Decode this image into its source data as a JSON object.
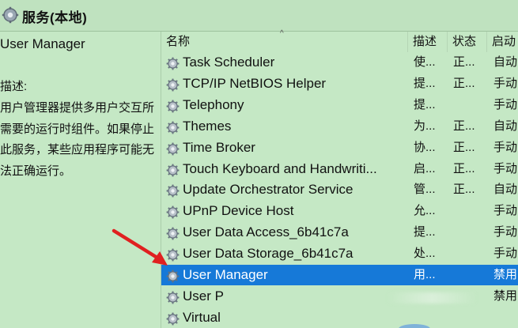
{
  "header": {
    "title": "服务(本地)"
  },
  "left_pane": {
    "service_name": "User Manager",
    "description_label": "描述:",
    "description_text": "用户管理器提供多用户交互所需要的运行时组件。如果停止此服务，某些应用程序可能无法正确运行。"
  },
  "columns": {
    "name": "名称",
    "description": "描述",
    "status": "状态",
    "startup": "启动"
  },
  "rows": [
    {
      "name": "Task Scheduler",
      "description": "使...",
      "status": "正...",
      "startup": "自动"
    },
    {
      "name": "TCP/IP NetBIOS Helper",
      "description": "提...",
      "status": "正...",
      "startup": "手动"
    },
    {
      "name": "Telephony",
      "description": "提...",
      "status": "",
      "startup": "手动"
    },
    {
      "name": "Themes",
      "description": "为...",
      "status": "正...",
      "startup": "自动"
    },
    {
      "name": "Time Broker",
      "description": "协...",
      "status": "正...",
      "startup": "手动"
    },
    {
      "name": "Touch Keyboard and Handwriti...",
      "description": "启...",
      "status": "正...",
      "startup": "手动"
    },
    {
      "name": "Update Orchestrator Service",
      "description": "管...",
      "status": "正...",
      "startup": "自动"
    },
    {
      "name": "UPnP Device Host",
      "description": "允...",
      "status": "",
      "startup": "手动"
    },
    {
      "name": "User Data Access_6b41c7a",
      "description": "提...",
      "status": "",
      "startup": "手动"
    },
    {
      "name": "User Data Storage_6b41c7a",
      "description": "处...",
      "status": "",
      "startup": "手动"
    },
    {
      "name": "User Manager",
      "description": "用...",
      "status": "",
      "startup": "禁用",
      "selected": true
    },
    {
      "name": "User P",
      "description": "",
      "status": "",
      "startup": "禁用"
    },
    {
      "name": "Virtual",
      "description": "",
      "status": "",
      "startup": ""
    }
  ],
  "colors": {
    "background": "#c5e8c5",
    "selection": "#1679d8",
    "arrow": "#e02020"
  },
  "icons": {
    "header": "services-gear-icon",
    "row": "gear-icon"
  }
}
